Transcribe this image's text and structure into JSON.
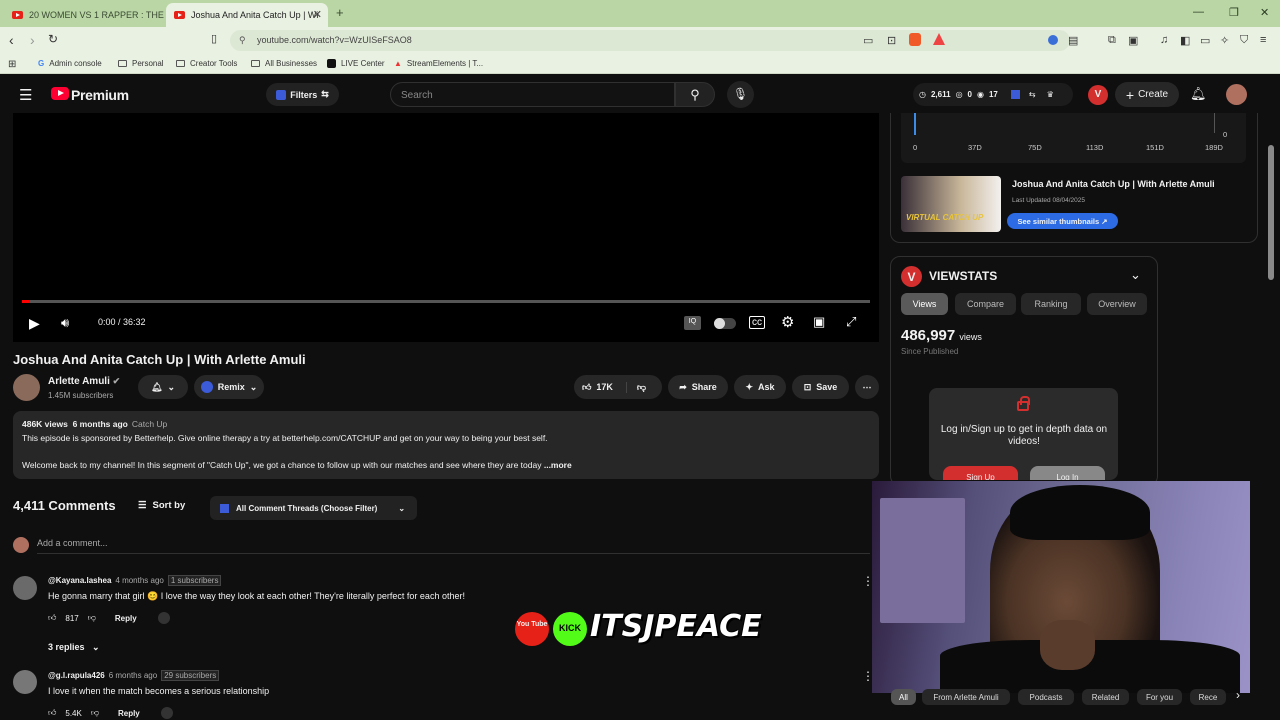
{
  "browser": {
    "tabs": [
      {
        "title": "20 WOMEN VS 1 RAPPER : THE GA"
      },
      {
        "title": "Joshua And Anita Catch Up | Wi"
      }
    ],
    "url": "youtube.com/watch?v=WzUISeFSAO8",
    "bookmarks": [
      "Admin console",
      "Personal",
      "Creator Tools",
      "All Businesses",
      "LIVE Center",
      "StreamElements | T..."
    ]
  },
  "yt_header": {
    "logo": "Premium",
    "filters": "Filters",
    "search_placeholder": "Search",
    "stat1": "2,611",
    "stat2": "0",
    "stat3": "17",
    "create": "Create"
  },
  "video": {
    "time": "0:00 / 36:32",
    "title": "Joshua And Anita Catch Up | With Arlette Amuli",
    "channel": "Arlette Amuli",
    "subscribers": "1.45M subscribers",
    "remix": "Remix",
    "likes": "17K",
    "share": "Share",
    "ask": "Ask",
    "save": "Save",
    "progress_fraction": 0.01
  },
  "description": {
    "views": "486K views",
    "age": "6 months ago",
    "tag": "Catch Up",
    "line1": "This episode is sponsored by Betterhelp. Give online therapy a try at betterhelp.com/CATCHUP and get on your way to being your best self.",
    "line2": "Welcome back to my channel! In this segment of \"Catch Up\", we got a chance to follow up with our matches and see where they are today",
    "more": "...more"
  },
  "comments": {
    "count": "4,411 Comments",
    "sort": "Sort by",
    "filter": "All Comment Threads (Choose Filter)",
    "add_placeholder": "Add a comment...",
    "items": [
      {
        "author": "@Kayana.lashea",
        "time": "4 months ago",
        "subs": "1 subscribers",
        "text": "He gonna marry that girl 😊 I love the way they look at each other! They're literally perfect for each other!",
        "likes": "817",
        "reply": "Reply",
        "replies": "3 replies"
      },
      {
        "author": "@g.l.rapula426",
        "time": "6 months ago",
        "subs": "29 subscribers",
        "text": "I love it when the match becomes a serious relationship",
        "likes": "5.4K",
        "reply": "Reply"
      }
    ]
  },
  "chart": {
    "ticks": [
      "0",
      "37D",
      "75D",
      "113D",
      "151D",
      "189D"
    ],
    "right_zero": "0"
  },
  "related": {
    "title": "Joshua And Anita Catch Up | With Arlette Amuli",
    "updated": "Last Updated 08/04/2025",
    "similar": "See similar thumbnails ↗",
    "thumb_text": "VIRTUAL CATCH UP"
  },
  "viewstats": {
    "title": "VIEWSTATS",
    "tabs": [
      "Views",
      "Compare",
      "Ranking",
      "Overview"
    ],
    "views_number": "486,997",
    "views_unit": "views",
    "since": "Since Published",
    "login_text": "Log in/Sign up to get in depth data on videos!",
    "signup": "Sign Up",
    "login": "Log In"
  },
  "chips": [
    "All",
    "From Arlette Amuli",
    "Podcasts",
    "Related",
    "For you",
    "Rece"
  ],
  "overlay": {
    "brand": "ITSJPEACE",
    "kick": "KICK",
    "youtube": "You Tube"
  },
  "colors": {
    "accent_red": "#ff0033",
    "chrome_green": "#b9d6a4",
    "link_blue": "#2d6be4"
  }
}
